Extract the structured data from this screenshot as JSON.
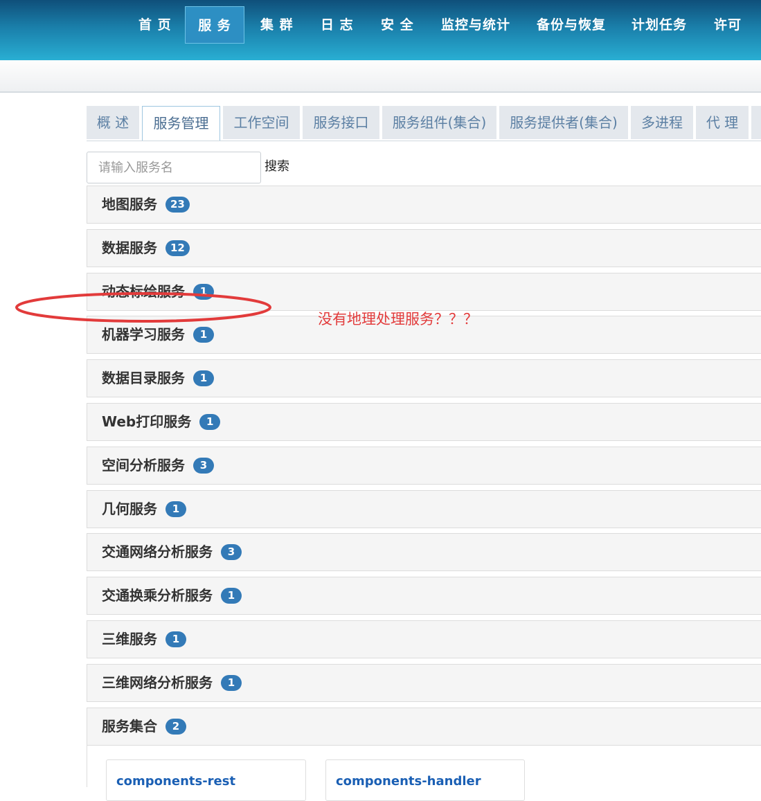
{
  "nav": {
    "items": [
      "首 页",
      "服 务",
      "集 群",
      "日 志",
      "安 全",
      "监控与统计",
      "备份与恢复",
      "计划任务",
      "许可"
    ],
    "active_index": 1
  },
  "tabs": {
    "items": [
      "概 述",
      "服务管理",
      "工作空间",
      "服务接口",
      "服务组件(集合)",
      "服务提供者(集合)",
      "多进程",
      "代 理"
    ],
    "active_index": 1
  },
  "search": {
    "placeholder": "请输入服务名",
    "button_label": "搜索"
  },
  "panels": [
    {
      "title": "地图服务",
      "count": "23"
    },
    {
      "title": "数据服务",
      "count": "12"
    },
    {
      "title": "动态标绘服务",
      "count": "1"
    },
    {
      "title": "机器学习服务",
      "count": "1"
    },
    {
      "title": "数据目录服务",
      "count": "1"
    },
    {
      "title": "Web打印服务",
      "count": "1"
    },
    {
      "title": "空间分析服务",
      "count": "3"
    },
    {
      "title": "几何服务",
      "count": "1"
    },
    {
      "title": "交通网络分析服务",
      "count": "3"
    },
    {
      "title": "交通换乘分析服务",
      "count": "1"
    },
    {
      "title": "三维服务",
      "count": "1"
    },
    {
      "title": "三维网络分析服务",
      "count": "1"
    },
    {
      "title": "服务集合",
      "count": "2"
    }
  ],
  "collection_cards": [
    "components-rest",
    "components-handler"
  ],
  "annotation": {
    "text": "没有地理处理服务？？？",
    "color": "#e23b3b"
  },
  "colors": {
    "badge": "#337ab7",
    "tab_text": "#5b7fa3",
    "link": "#1a5fb4"
  }
}
